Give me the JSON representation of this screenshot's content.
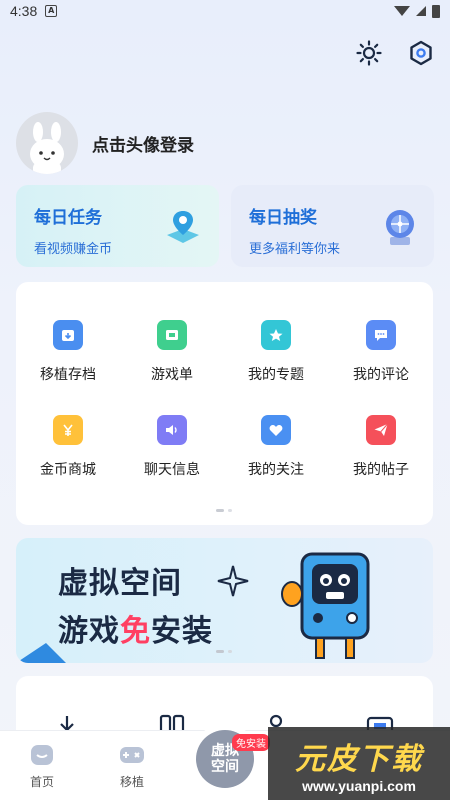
{
  "status_bar": {
    "time": "4:38",
    "sim_label": "A"
  },
  "profile": {
    "login_text": "点击头像登录"
  },
  "daily_task": {
    "title": "每日任务",
    "subtitle": "看视频赚金币"
  },
  "daily_lottery": {
    "title": "每日抽奖",
    "subtitle": "更多福利等你来"
  },
  "grid": {
    "items": [
      {
        "label": "移植存档",
        "icon": "archive-download-icon",
        "color": "#4a8ef0"
      },
      {
        "label": "游戏单",
        "icon": "game-list-icon",
        "color": "#3fcf8e"
      },
      {
        "label": "我的专题",
        "icon": "topic-star-icon",
        "color": "#33c6d6"
      },
      {
        "label": "我的评论",
        "icon": "comment-icon",
        "color": "#5b8cf5"
      },
      {
        "label": "金币商城",
        "icon": "coin-mall-icon",
        "color": "#ffc13a"
      },
      {
        "label": "聊天信息",
        "icon": "chat-speaker-icon",
        "color": "#7f7cf5"
      },
      {
        "label": "我的关注",
        "icon": "heart-follow-icon",
        "color": "#4a90f2"
      },
      {
        "label": "我的帖子",
        "icon": "paper-plane-icon",
        "color": "#f5505a"
      }
    ]
  },
  "banner": {
    "line1": "虚拟空间",
    "line2_prefix": "游戏",
    "line2_highlight": "免",
    "line2_suffix": "安装"
  },
  "bottom_nav": {
    "home_label": "首页",
    "port_label": "移植",
    "center_label": "虚拟空间",
    "center_badge": "免安装"
  },
  "watermark": {
    "title": "元皮下载",
    "url": "www.yuanpi.com"
  }
}
